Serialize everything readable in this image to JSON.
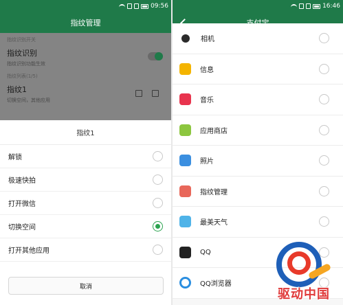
{
  "left": {
    "status": {
      "time": "09:56"
    },
    "title": "指纹管理",
    "dimmed": {
      "section_switch": "指纹识别开关",
      "fingerprint_recognition": {
        "title": "指纹识别",
        "subtitle": "指纹识别功能生效"
      },
      "section_list": "指纹列表(1/5)",
      "fingerprint_item": {
        "title": "指纹1",
        "subtitle": "切换空间，其他应用"
      }
    },
    "sheet": {
      "title": "指纹1",
      "options": [
        {
          "label": "解锁",
          "selected": false
        },
        {
          "label": "极速快拍",
          "selected": false
        },
        {
          "label": "打开微信",
          "selected": false
        },
        {
          "label": "切换空间",
          "selected": true
        },
        {
          "label": "打开其他应用",
          "selected": false
        }
      ],
      "cancel_label": "取消"
    }
  },
  "right": {
    "status": {
      "time": "16:46"
    },
    "title": "支付宝",
    "apps": [
      {
        "label": "相机",
        "icon": "camera-icon",
        "color": "#2b2b2b"
      },
      {
        "label": "信息",
        "icon": "message-icon",
        "color": "#f4b400"
      },
      {
        "label": "音乐",
        "icon": "music-icon",
        "color": "#e8344e"
      },
      {
        "label": "应用商店",
        "icon": "store-icon",
        "color": "#8cc63f"
      },
      {
        "label": "照片",
        "icon": "photos-icon",
        "color": "#3b8fe0"
      },
      {
        "label": "指纹管理",
        "icon": "fingerprint-icon",
        "color": "#e8675a"
      },
      {
        "label": "最美天气",
        "icon": "weather-icon",
        "color": "#4fb3e8"
      },
      {
        "label": "QQ",
        "icon": "qq-icon",
        "color": "#222222"
      },
      {
        "label": "QQ浏览器",
        "icon": "qq-browser-icon",
        "color": "#2a8ee0"
      }
    ]
  },
  "watermark": {
    "text": "驱动中国"
  },
  "colors": {
    "accent_green": "#2aa24e",
    "appbar_green": "#1f7a49"
  }
}
